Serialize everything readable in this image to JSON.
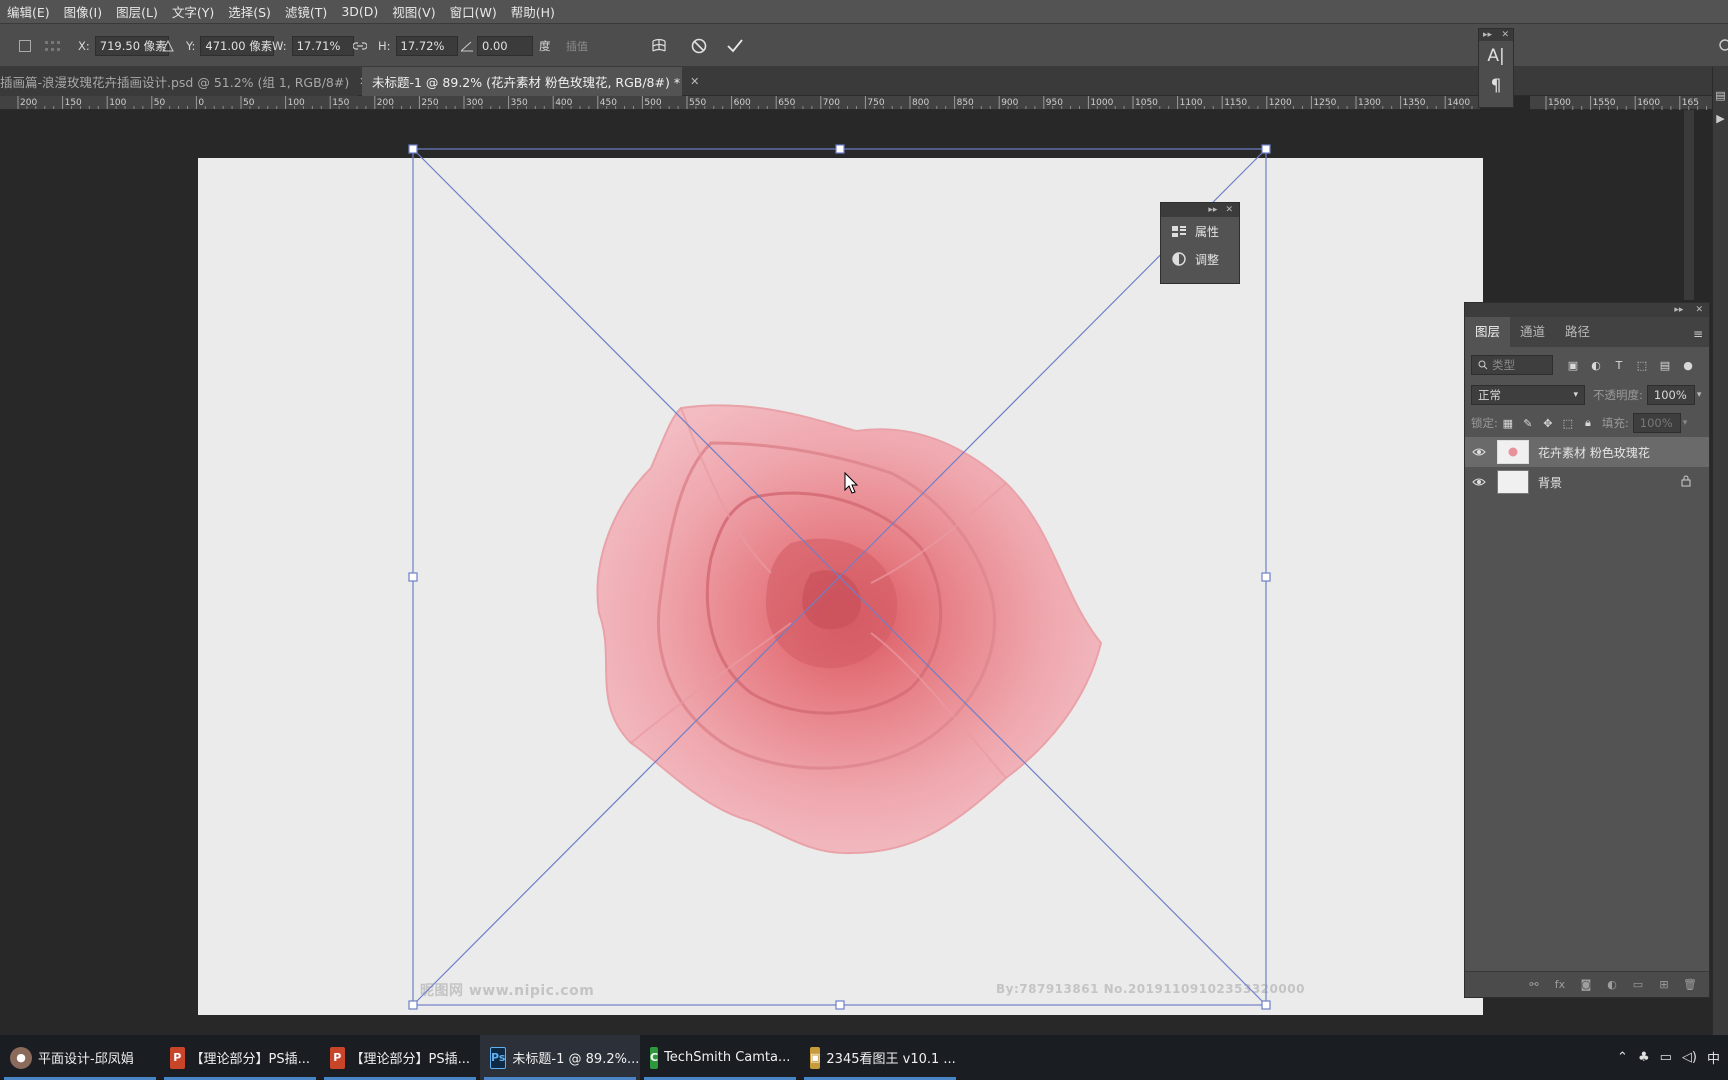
{
  "menu": [
    "编辑(E)",
    "图像(I)",
    "图层(L)",
    "文字(Y)",
    "选择(S)",
    "滤镜(T)",
    "3D(D)",
    "视图(V)",
    "窗口(W)",
    "帮助(H)"
  ],
  "options": {
    "x_label": "X:",
    "x_value": "719.50 像素",
    "y_label": "Y:",
    "y_value": "471.00 像素",
    "w_label": "W:",
    "w_value": "17.71%",
    "h_label": "H:",
    "h_value": "17.72%",
    "angle_value": "0.00",
    "angle_unit": "度",
    "interp": "插值",
    "cancel_icon": "cancel-transform-icon",
    "commit_icon": "commit-transform-icon"
  },
  "tabs": [
    {
      "label": "插画篇-浪漫玫瑰花卉插画设计.psd @ 51.2% (组 1, RGB/8#)",
      "active": false
    },
    {
      "label": "未标题-1 @ 89.2% (花卉素材 粉色玫瑰花, RGB/8#) *",
      "active": true
    }
  ],
  "ruler_ticks": [
    "200",
    "150",
    "100",
    "50",
    "0",
    "50",
    "100",
    "150",
    "200",
    "250",
    "300",
    "350",
    "400",
    "450",
    "500",
    "550",
    "600",
    "650",
    "700",
    "750",
    "800",
    "850",
    "900",
    "950",
    "1000",
    "1050",
    "1100",
    "1150",
    "1200",
    "1250",
    "1300",
    "1350",
    "1400"
  ],
  "ruler_ticks_right": [
    "1500",
    "1550",
    "1600",
    "165"
  ],
  "canvas": {
    "watermark_left": "昵图网 www.nipic.com",
    "watermark_right": "By:787913861 No.20191109102353320000"
  },
  "props_panel": {
    "items": [
      {
        "label": "属性",
        "icon": "properties-icon"
      },
      {
        "label": "调整",
        "icon": "adjustments-icon"
      }
    ]
  },
  "layers_panel": {
    "tabs": [
      "图层",
      "通道",
      "路径"
    ],
    "search_placeholder": "类型",
    "blend_mode": "正常",
    "opacity_label": "不透明度:",
    "opacity_value": "100%",
    "lock_label": "锁定:",
    "fill_label": "填充:",
    "fill_value": "100%",
    "layers": [
      {
        "name": "花卉素材 粉色玫瑰花",
        "selected": true,
        "visible": true
      },
      {
        "name": "背景",
        "selected": false,
        "visible": true,
        "locked": true
      }
    ]
  },
  "taskbar": {
    "items": [
      {
        "label": "平面设计-邱凤娟",
        "icon": "user-avatar-icon",
        "color": "#8a6a5a"
      },
      {
        "label": "【理论部分】PS插...",
        "icon": "powerpoint-icon",
        "color": "#c8452a"
      },
      {
        "label": "【理论部分】PS插...",
        "icon": "powerpoint-icon",
        "color": "#c8452a"
      },
      {
        "label": "未标题-1 @ 89.2%...",
        "icon": "photoshop-icon",
        "color": "#0f2a44"
      },
      {
        "label": "TechSmith Camta...",
        "icon": "camtasia-icon",
        "color": "#2c9a3c"
      },
      {
        "label": "2345看图王 v10.1 ...",
        "icon": "image-viewer-icon",
        "color": "#c79a3a"
      }
    ],
    "ime": "中"
  },
  "colors": {
    "accent_blue": "#4a86c5",
    "transform_line": "#6e7fc8",
    "rose": "#e8919a"
  }
}
